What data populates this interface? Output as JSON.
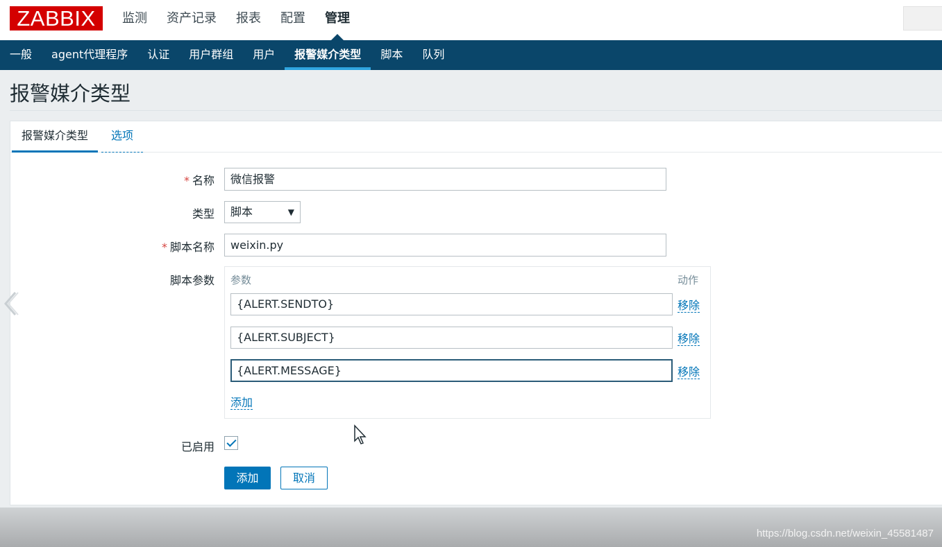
{
  "app": {
    "logo": "ZABBIX"
  },
  "main_nav": [
    {
      "label": "监测",
      "active": false
    },
    {
      "label": "资产记录",
      "active": false
    },
    {
      "label": "报表",
      "active": false
    },
    {
      "label": "配置",
      "active": false
    },
    {
      "label": "管理",
      "active": true
    }
  ],
  "sub_nav": [
    {
      "label": "一般",
      "active": false
    },
    {
      "label": "agent代理程序",
      "active": false
    },
    {
      "label": "认证",
      "active": false
    },
    {
      "label": "用户群组",
      "active": false
    },
    {
      "label": "用户",
      "active": false
    },
    {
      "label": "报警媒介类型",
      "active": true
    },
    {
      "label": "脚本",
      "active": false
    },
    {
      "label": "队列",
      "active": false
    }
  ],
  "page": {
    "title": "报警媒介类型"
  },
  "tabs": [
    {
      "label": "报警媒介类型",
      "active": true
    },
    {
      "label": "选项",
      "active": false
    }
  ],
  "form": {
    "required_mark": "*",
    "name_label": "名称",
    "name_value": "微信报警",
    "type_label": "类型",
    "type_value": "脚本",
    "type_arrow": "▼",
    "script_name_label": "脚本名称",
    "script_name_value": "weixin.py",
    "script_params_label": "脚本参数",
    "params": {
      "header_param": "参数",
      "header_action": "动作",
      "rows": [
        {
          "value": "{ALERT.SENDTO}",
          "action": "移除"
        },
        {
          "value": "{ALERT.SUBJECT}",
          "action": "移除"
        },
        {
          "value": "{ALERT.MESSAGE}",
          "action": "移除"
        }
      ],
      "add_link": "添加"
    },
    "enabled_label": "已启用",
    "enabled": true,
    "submit_button": "添加",
    "cancel_button": "取消"
  },
  "watermark": "https://blog.csdn.net/weixin_45581487",
  "colors": {
    "brand_red": "#d40000",
    "nav_dark": "#0a466a",
    "accent_blue": "#0275b8",
    "active_tab_underline": "#2fa5e0"
  }
}
